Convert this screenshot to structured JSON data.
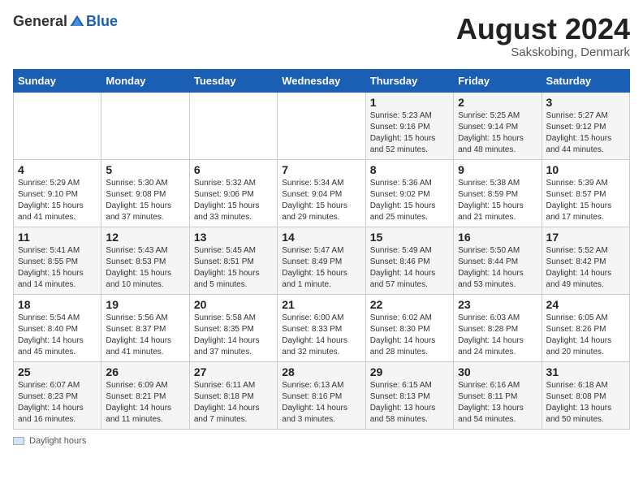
{
  "header": {
    "logo_general": "General",
    "logo_blue": "Blue",
    "month_year": "August 2024",
    "location": "Sakskobing, Denmark"
  },
  "legend": {
    "label": "Daylight hours"
  },
  "days_of_week": [
    "Sunday",
    "Monday",
    "Tuesday",
    "Wednesday",
    "Thursday",
    "Friday",
    "Saturday"
  ],
  "weeks": [
    {
      "days": [
        {
          "num": "",
          "info": ""
        },
        {
          "num": "",
          "info": ""
        },
        {
          "num": "",
          "info": ""
        },
        {
          "num": "",
          "info": ""
        },
        {
          "num": "1",
          "info": "Sunrise: 5:23 AM\nSunset: 9:16 PM\nDaylight: 15 hours\nand 52 minutes."
        },
        {
          "num": "2",
          "info": "Sunrise: 5:25 AM\nSunset: 9:14 PM\nDaylight: 15 hours\nand 48 minutes."
        },
        {
          "num": "3",
          "info": "Sunrise: 5:27 AM\nSunset: 9:12 PM\nDaylight: 15 hours\nand 44 minutes."
        }
      ]
    },
    {
      "days": [
        {
          "num": "4",
          "info": "Sunrise: 5:29 AM\nSunset: 9:10 PM\nDaylight: 15 hours\nand 41 minutes."
        },
        {
          "num": "5",
          "info": "Sunrise: 5:30 AM\nSunset: 9:08 PM\nDaylight: 15 hours\nand 37 minutes."
        },
        {
          "num": "6",
          "info": "Sunrise: 5:32 AM\nSunset: 9:06 PM\nDaylight: 15 hours\nand 33 minutes."
        },
        {
          "num": "7",
          "info": "Sunrise: 5:34 AM\nSunset: 9:04 PM\nDaylight: 15 hours\nand 29 minutes."
        },
        {
          "num": "8",
          "info": "Sunrise: 5:36 AM\nSunset: 9:02 PM\nDaylight: 15 hours\nand 25 minutes."
        },
        {
          "num": "9",
          "info": "Sunrise: 5:38 AM\nSunset: 8:59 PM\nDaylight: 15 hours\nand 21 minutes."
        },
        {
          "num": "10",
          "info": "Sunrise: 5:39 AM\nSunset: 8:57 PM\nDaylight: 15 hours\nand 17 minutes."
        }
      ]
    },
    {
      "days": [
        {
          "num": "11",
          "info": "Sunrise: 5:41 AM\nSunset: 8:55 PM\nDaylight: 15 hours\nand 14 minutes."
        },
        {
          "num": "12",
          "info": "Sunrise: 5:43 AM\nSunset: 8:53 PM\nDaylight: 15 hours\nand 10 minutes."
        },
        {
          "num": "13",
          "info": "Sunrise: 5:45 AM\nSunset: 8:51 PM\nDaylight: 15 hours\nand 5 minutes."
        },
        {
          "num": "14",
          "info": "Sunrise: 5:47 AM\nSunset: 8:49 PM\nDaylight: 15 hours\nand 1 minute."
        },
        {
          "num": "15",
          "info": "Sunrise: 5:49 AM\nSunset: 8:46 PM\nDaylight: 14 hours\nand 57 minutes."
        },
        {
          "num": "16",
          "info": "Sunrise: 5:50 AM\nSunset: 8:44 PM\nDaylight: 14 hours\nand 53 minutes."
        },
        {
          "num": "17",
          "info": "Sunrise: 5:52 AM\nSunset: 8:42 PM\nDaylight: 14 hours\nand 49 minutes."
        }
      ]
    },
    {
      "days": [
        {
          "num": "18",
          "info": "Sunrise: 5:54 AM\nSunset: 8:40 PM\nDaylight: 14 hours\nand 45 minutes."
        },
        {
          "num": "19",
          "info": "Sunrise: 5:56 AM\nSunset: 8:37 PM\nDaylight: 14 hours\nand 41 minutes."
        },
        {
          "num": "20",
          "info": "Sunrise: 5:58 AM\nSunset: 8:35 PM\nDaylight: 14 hours\nand 37 minutes."
        },
        {
          "num": "21",
          "info": "Sunrise: 6:00 AM\nSunset: 8:33 PM\nDaylight: 14 hours\nand 32 minutes."
        },
        {
          "num": "22",
          "info": "Sunrise: 6:02 AM\nSunset: 8:30 PM\nDaylight: 14 hours\nand 28 minutes."
        },
        {
          "num": "23",
          "info": "Sunrise: 6:03 AM\nSunset: 8:28 PM\nDaylight: 14 hours\nand 24 minutes."
        },
        {
          "num": "24",
          "info": "Sunrise: 6:05 AM\nSunset: 8:26 PM\nDaylight: 14 hours\nand 20 minutes."
        }
      ]
    },
    {
      "days": [
        {
          "num": "25",
          "info": "Sunrise: 6:07 AM\nSunset: 8:23 PM\nDaylight: 14 hours\nand 16 minutes."
        },
        {
          "num": "26",
          "info": "Sunrise: 6:09 AM\nSunset: 8:21 PM\nDaylight: 14 hours\nand 11 minutes."
        },
        {
          "num": "27",
          "info": "Sunrise: 6:11 AM\nSunset: 8:18 PM\nDaylight: 14 hours\nand 7 minutes."
        },
        {
          "num": "28",
          "info": "Sunrise: 6:13 AM\nSunset: 8:16 PM\nDaylight: 14 hours\nand 3 minutes."
        },
        {
          "num": "29",
          "info": "Sunrise: 6:15 AM\nSunset: 8:13 PM\nDaylight: 13 hours\nand 58 minutes."
        },
        {
          "num": "30",
          "info": "Sunrise: 6:16 AM\nSunset: 8:11 PM\nDaylight: 13 hours\nand 54 minutes."
        },
        {
          "num": "31",
          "info": "Sunrise: 6:18 AM\nSunset: 8:08 PM\nDaylight: 13 hours\nand 50 minutes."
        }
      ]
    }
  ]
}
